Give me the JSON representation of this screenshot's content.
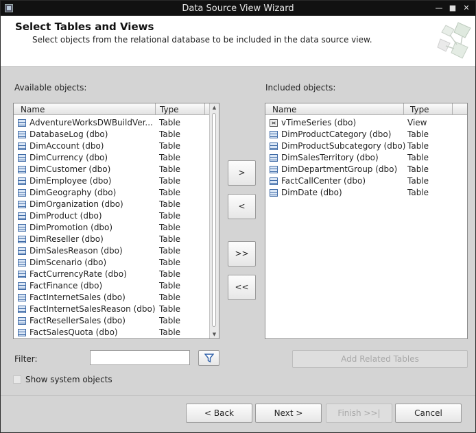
{
  "window": {
    "title": "Data Source View Wizard"
  },
  "header": {
    "title": "Select Tables and Views",
    "subtitle": "Select objects from the relational database to be included in the data source view."
  },
  "available": {
    "label": "Available objects:",
    "col_name": "Name",
    "col_type": "Type",
    "items": [
      {
        "name": "AdventureWorksDWBuildVer...",
        "type": "Table",
        "icon": "table-icon"
      },
      {
        "name": "DatabaseLog (dbo)",
        "type": "Table",
        "icon": "table-icon"
      },
      {
        "name": "DimAccount (dbo)",
        "type": "Table",
        "icon": "table-icon"
      },
      {
        "name": "DimCurrency (dbo)",
        "type": "Table",
        "icon": "table-icon"
      },
      {
        "name": "DimCustomer (dbo)",
        "type": "Table",
        "icon": "table-icon"
      },
      {
        "name": "DimEmployee (dbo)",
        "type": "Table",
        "icon": "table-icon"
      },
      {
        "name": "DimGeography (dbo)",
        "type": "Table",
        "icon": "table-icon"
      },
      {
        "name": "DimOrganization (dbo)",
        "type": "Table",
        "icon": "table-icon"
      },
      {
        "name": "DimProduct (dbo)",
        "type": "Table",
        "icon": "table-icon"
      },
      {
        "name": "DimPromotion (dbo)",
        "type": "Table",
        "icon": "table-icon"
      },
      {
        "name": "DimReseller (dbo)",
        "type": "Table",
        "icon": "table-icon"
      },
      {
        "name": "DimSalesReason (dbo)",
        "type": "Table",
        "icon": "table-icon"
      },
      {
        "name": "DimScenario (dbo)",
        "type": "Table",
        "icon": "table-icon"
      },
      {
        "name": "FactCurrencyRate (dbo)",
        "type": "Table",
        "icon": "table-icon"
      },
      {
        "name": "FactFinance (dbo)",
        "type": "Table",
        "icon": "table-icon"
      },
      {
        "name": "FactInternetSales (dbo)",
        "type": "Table",
        "icon": "table-icon"
      },
      {
        "name": "FactInternetSalesReason (dbo)",
        "type": "Table",
        "icon": "table-icon"
      },
      {
        "name": "FactResellerSales (dbo)",
        "type": "Table",
        "icon": "table-icon"
      },
      {
        "name": "FactSalesQuota (dbo)",
        "type": "Table",
        "icon": "table-icon"
      }
    ]
  },
  "included": {
    "label": "Included objects:",
    "col_name": "Name",
    "col_type": "Type",
    "items": [
      {
        "name": "vTimeSeries (dbo)",
        "type": "View",
        "icon": "view-icon"
      },
      {
        "name": "DimProductCategory (dbo)",
        "type": "Table",
        "icon": "table-icon"
      },
      {
        "name": "DimProductSubcategory (dbo)",
        "type": "Table",
        "icon": "table-icon"
      },
      {
        "name": "DimSalesTerritory (dbo)",
        "type": "Table",
        "icon": "table-icon"
      },
      {
        "name": "DimDepartmentGroup (dbo)",
        "type": "Table",
        "icon": "table-icon"
      },
      {
        "name": "FactCallCenter (dbo)",
        "type": "Table",
        "icon": "table-icon"
      },
      {
        "name": "DimDate (dbo)",
        "type": "Table",
        "icon": "table-icon"
      }
    ]
  },
  "transfer": {
    "add": ">",
    "remove": "<",
    "add_all": ">>",
    "remove_all": "<<"
  },
  "filter": {
    "label": "Filter:",
    "value": ""
  },
  "add_related_label": "Add Related Tables",
  "show_system_label": "Show system objects",
  "footer": {
    "back": "< Back",
    "next": "Next >",
    "finish": "Finish >>|",
    "cancel": "Cancel"
  }
}
